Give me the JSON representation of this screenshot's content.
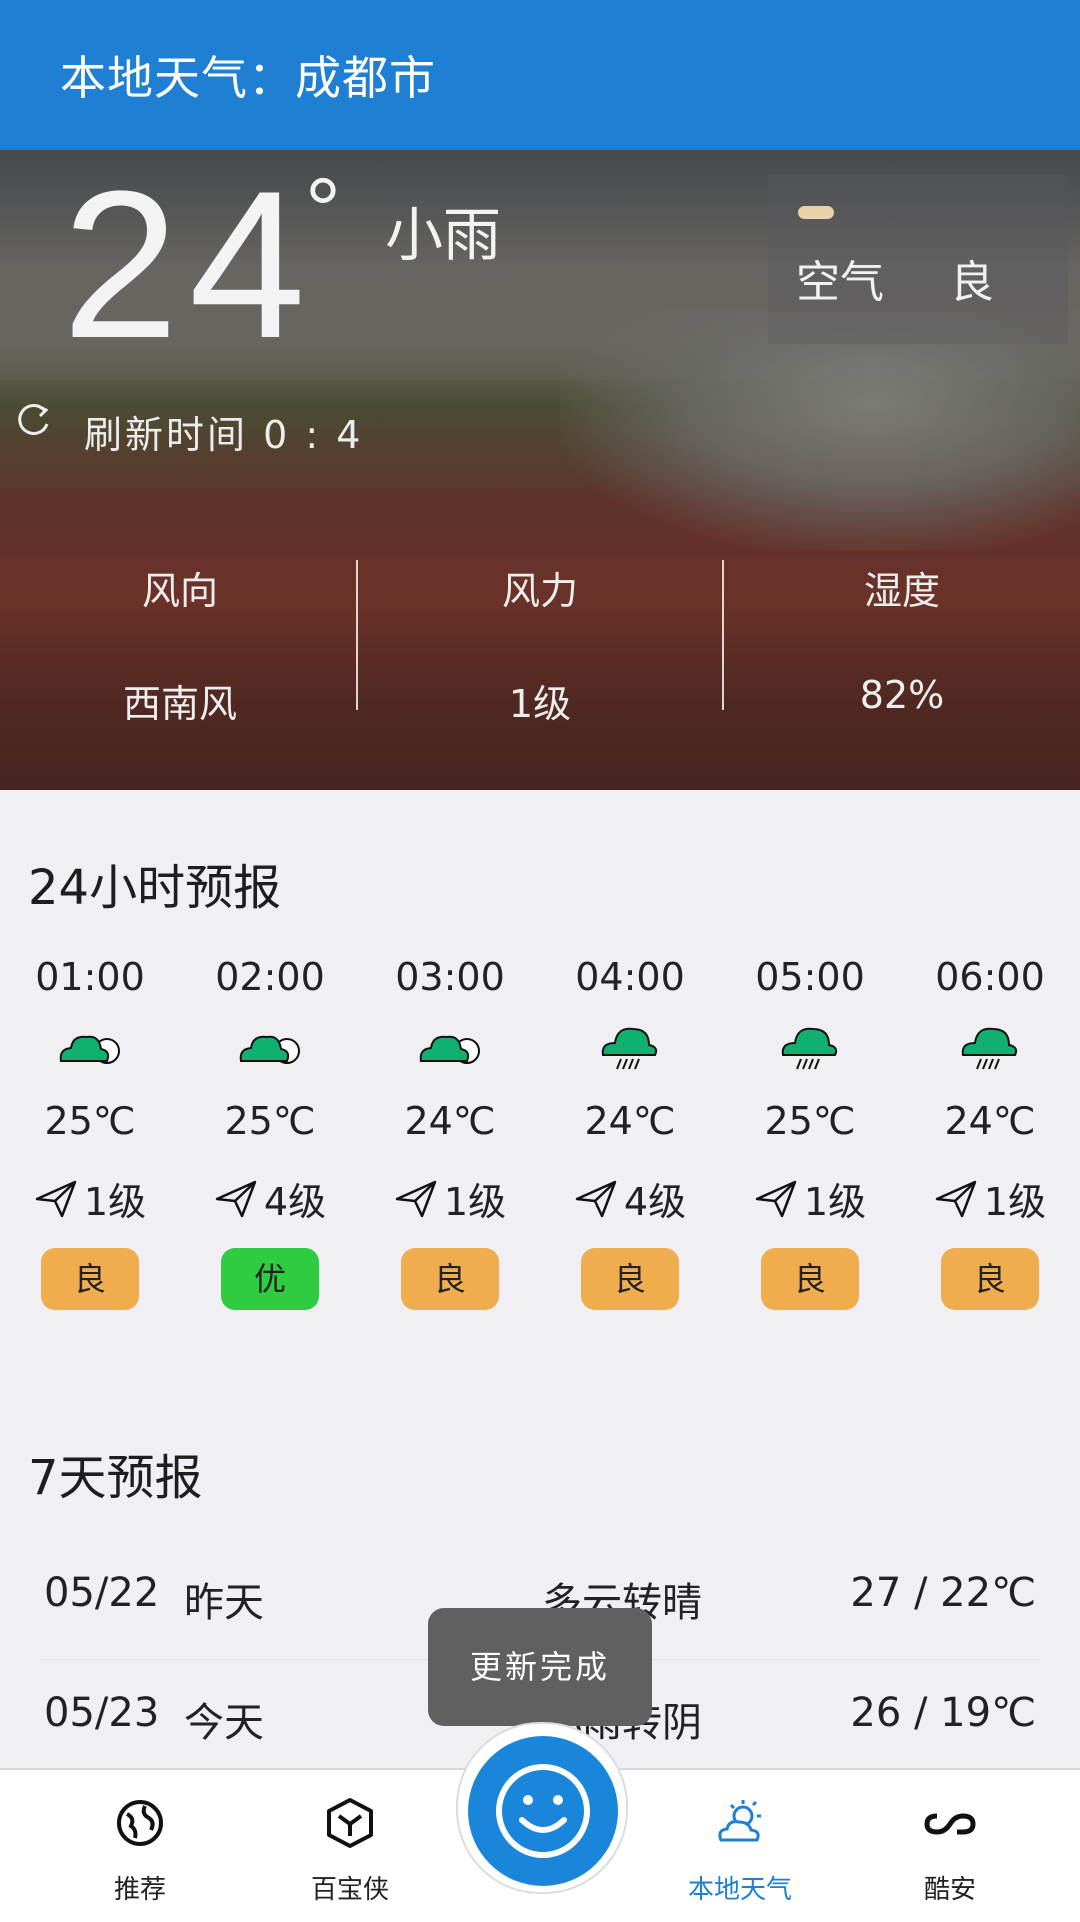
{
  "app_bar": {
    "title": "本地天气：成都市"
  },
  "current": {
    "temperature": "24",
    "degree_symbol": "°",
    "condition": "小雨",
    "air_label": "空气",
    "air_value": "良",
    "refresh_text": "刷新时间 0 : 4"
  },
  "stats": [
    {
      "label": "风向",
      "value": "西南风"
    },
    {
      "label": "风力",
      "value": "1级"
    },
    {
      "label": "湿度",
      "value": "82%"
    }
  ],
  "hourly_title": "24小时预报",
  "hourly": [
    {
      "time": "01:00",
      "icon": "cloudy-icon",
      "temp": "25℃",
      "wind": "1级",
      "aqi": "良",
      "aqi_color": "#f0ad4e"
    },
    {
      "time": "02:00",
      "icon": "cloudy-icon",
      "temp": "25℃",
      "wind": "4级",
      "aqi": "优",
      "aqi_color": "#2ecc40"
    },
    {
      "time": "03:00",
      "icon": "cloudy-icon",
      "temp": "24℃",
      "wind": "1级",
      "aqi": "良",
      "aqi_color": "#f0ad4e"
    },
    {
      "time": "04:00",
      "icon": "rain-icon",
      "temp": "24℃",
      "wind": "4级",
      "aqi": "良",
      "aqi_color": "#f0ad4e"
    },
    {
      "time": "05:00",
      "icon": "rain-icon",
      "temp": "25℃",
      "wind": "1级",
      "aqi": "良",
      "aqi_color": "#f0ad4e"
    },
    {
      "time": "06:00",
      "icon": "rain-icon",
      "temp": "24℃",
      "wind": "1级",
      "aqi": "良",
      "aqi_color": "#f0ad4e"
    }
  ],
  "daily_title": "7天预报",
  "daily": [
    {
      "date": "05/22",
      "day": "昨天",
      "condition": "多云转晴",
      "range": "27 / 22℃"
    },
    {
      "date": "05/23",
      "day": "今天",
      "condition": "小雨转阴",
      "range": "26 / 19℃"
    }
  ],
  "toast": "更新完成",
  "nav": [
    {
      "label": "推荐",
      "icon": "globe-icon"
    },
    {
      "label": "百宝侠",
      "icon": "cube-icon"
    },
    {
      "label": "",
      "icon": "smiley-icon"
    },
    {
      "label": "本地天气",
      "icon": "weather-icon",
      "active": true
    },
    {
      "label": "酷安",
      "icon": "coolapk-icon"
    }
  ],
  "colors": {
    "primary": "#1e7fd3",
    "good": "#f0ad4e",
    "excellent": "#2ecc40",
    "icon_green": "#10b070"
  }
}
